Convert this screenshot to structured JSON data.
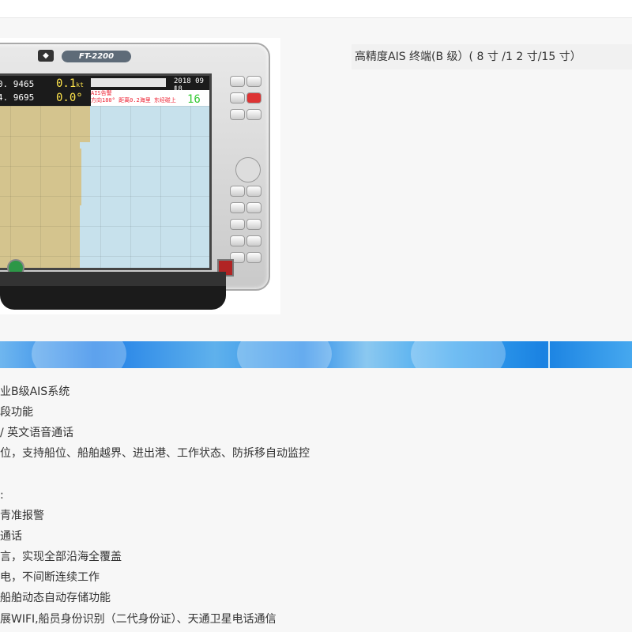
{
  "product": {
    "model": "FT-2200",
    "title": "高精度AIS 终端(B 级）( 8 寸 /1 2 寸/15 寸）",
    "screen": {
      "latitude": "° 20. 9465",
      "longitude": "° 04. 9695",
      "speed": "0.1",
      "speed_unit": "kt",
      "course": "0.0°",
      "date": "2018 09 18",
      "time": "L 11:44:22",
      "ais_label": "AIS告警",
      "ais_detail": "方向180° 距离0.2海里 东经碰上",
      "channel": "16"
    }
  },
  "features": [
    "业B级AIS系统",
    "段功能",
    "/ 英文语音通话",
    "位，支持船位、船舶越界、进出港、工作状态、防拆移自动监控",
    ":",
    "青准报警",
    "通话",
    "言，实现全部沿海全覆盖",
    "电，不间断连续工作",
    "船舶动态自动存储功能",
    "展WIFI,船员身份识别（二代身份证）、天通卫星电话通信"
  ]
}
